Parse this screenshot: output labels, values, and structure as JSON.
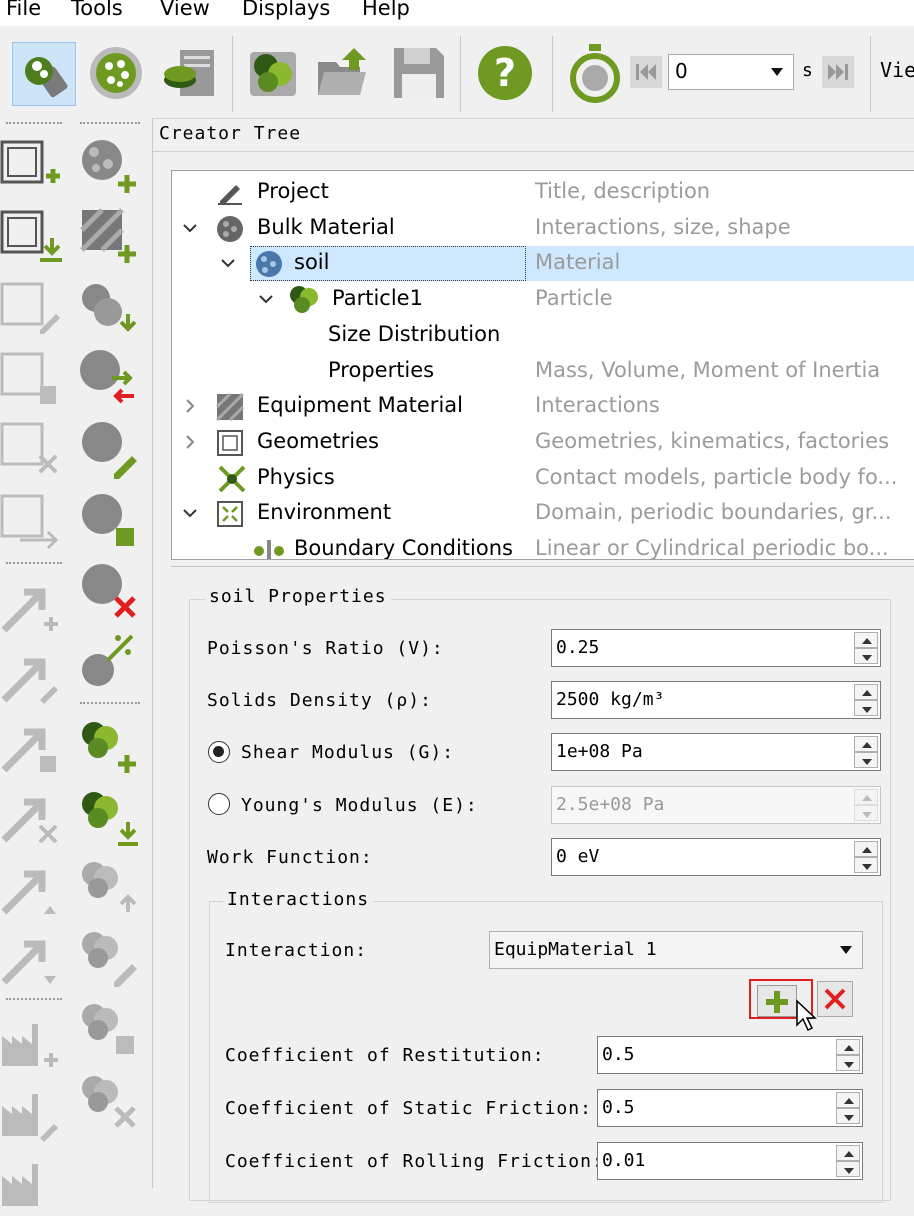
{
  "menu": [
    "File",
    "Tools",
    "View",
    "Displays",
    "Help"
  ],
  "toolbar": {
    "time_value": "0",
    "time_unit": "s",
    "view_label": "Vie",
    "icons": [
      "creator-icon",
      "simulator-icon",
      "analyst-icon",
      "bulk-material-icon",
      "open-folder-icon",
      "save-icon",
      "help-icon",
      "stopwatch-icon",
      "skip-back-icon",
      "skip-forward-icon"
    ]
  },
  "creator_tree": {
    "title": "Creator Tree",
    "rows": [
      {
        "label": "Project",
        "desc": "Title, description"
      },
      {
        "label": "Bulk Material",
        "desc": "Interactions, size, shape"
      },
      {
        "label": "soil",
        "desc": "Material"
      },
      {
        "label": "Particle1",
        "desc": "Particle"
      },
      {
        "label": "Size Distribution",
        "desc": ""
      },
      {
        "label": "Properties",
        "desc": "Mass, Volume, Moment of Inertia"
      },
      {
        "label": "Equipment Material",
        "desc": "Interactions"
      },
      {
        "label": "Geometries",
        "desc": "Geometries, kinematics, factories"
      },
      {
        "label": "Physics",
        "desc": "Contact models, particle body fo..."
      },
      {
        "label": "Environment",
        "desc": "Domain, periodic boundaries, gr..."
      },
      {
        "label": "Boundary Conditions",
        "desc": "Linear or Cylindrical periodic bo..."
      }
    ]
  },
  "properties": {
    "title": "soil Properties",
    "poisson_label": "Poisson's Ratio (V):",
    "poisson_value": "0.25",
    "density_label": "Solids Density (ρ):",
    "density_value": "2500 kg/m³",
    "shear_label": "Shear Modulus (G):",
    "shear_value": "1e+08 Pa",
    "young_label": "Young's Modulus (E):",
    "young_value": "2.5e+08 Pa",
    "work_label": "Work Function:",
    "work_value": "0 eV",
    "shear_selected": true
  },
  "interactions": {
    "title": "Interactions",
    "interaction_label": "Interaction:",
    "interaction_value": "EquipMaterial 1",
    "restitution_label": "Coefficient of Restitution:",
    "restitution_value": "0.5",
    "static_label": "Coefficient of Static Friction:",
    "static_value": "0.5",
    "rolling_label": "Coefficient of Rolling Friction:",
    "rolling_value": "0.01"
  },
  "colors": {
    "accent_green": "#6e9a22",
    "selection": "#cde8ff",
    "highlight_red": "#e02020"
  }
}
